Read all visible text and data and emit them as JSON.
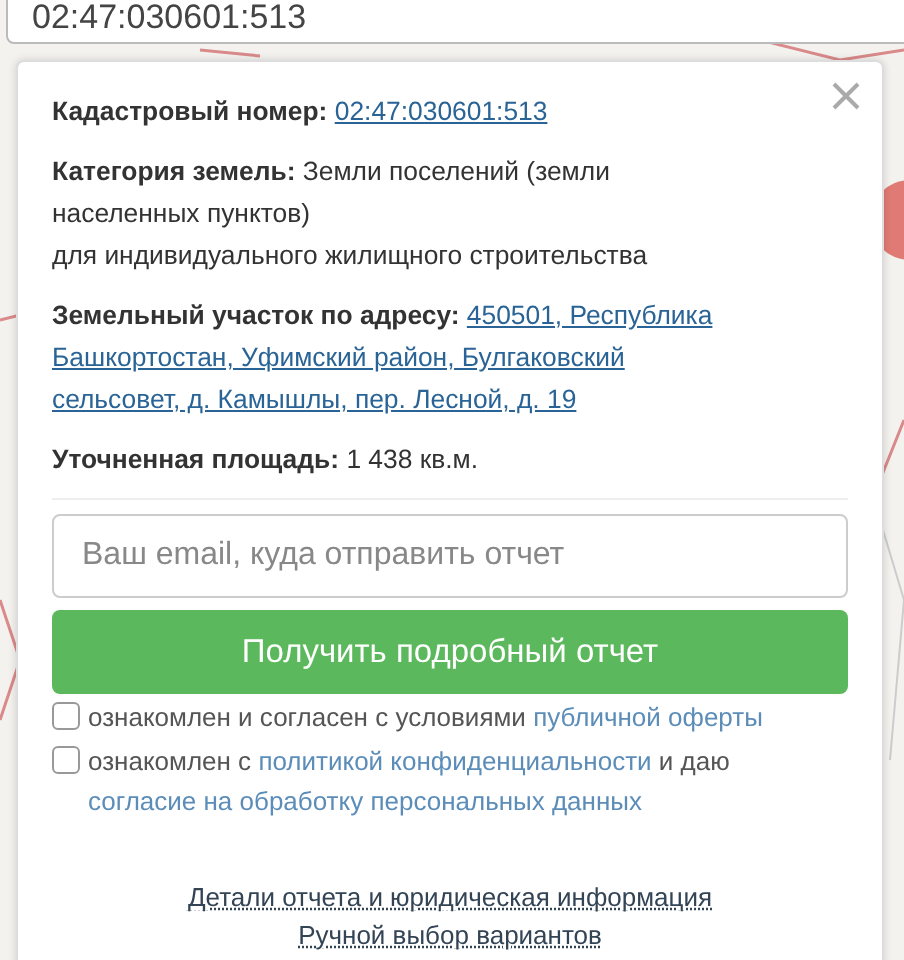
{
  "search": {
    "value": "02:47:030601:513"
  },
  "popup": {
    "fields": [
      {
        "label": "Кадастровый номер:",
        "value": "02:47:030601:513",
        "kind": "link"
      },
      {
        "label": "Категория земель:",
        "value_lines": [
          "Земли поселений (земли",
          "населенных пунктов)"
        ],
        "kind": "text",
        "note": "для индивидуального жилищного строительства"
      },
      {
        "label": "Земельный участок по адресу:",
        "value_lines": [
          "450501, Республика",
          "Башкортостан, Уфимский район, Булгаковский",
          "сельсовет, д. Камышлы, пер. Лесной, д. 19"
        ],
        "kind": "link"
      },
      {
        "label": "Уточненная площадь:",
        "value": "1 438 кв.м.",
        "kind": "text"
      }
    ],
    "email": {
      "placeholder": "Ваш email, куда отправить отчет"
    },
    "submit": "Получить подробный отчет",
    "agreements": [
      {
        "checked": false,
        "parts": [
          {
            "kind": "text",
            "text": "ознакомлен и согласен с условиями "
          },
          {
            "kind": "link",
            "text": "публичной оферты"
          }
        ]
      },
      {
        "checked": false,
        "parts": [
          {
            "kind": "text",
            "text": "ознакомлен с "
          },
          {
            "kind": "link",
            "text": "политикой конфиденциальности"
          },
          {
            "kind": "text",
            "text": " и даю "
          },
          {
            "kind": "link",
            "text": "согласие на обработку персональных данных"
          }
        ]
      }
    ],
    "footer_links": [
      "Детали отчета и юридическая информация",
      "Ручной выбор вариантов"
    ]
  }
}
